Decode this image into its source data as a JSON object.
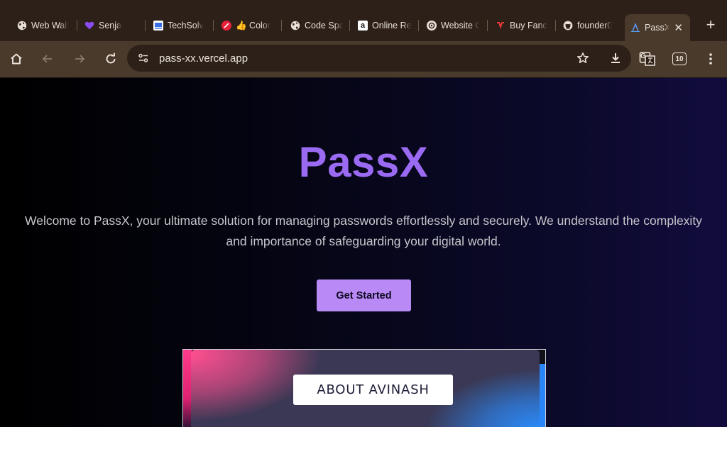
{
  "browser": {
    "tabs": [
      {
        "title": "Web Wall",
        "icon": "globe-icon"
      },
      {
        "title": "Senja",
        "icon": "heart-icon"
      },
      {
        "title": "TechSolv",
        "icon": "techsolv-icon"
      },
      {
        "title": "👍 Color",
        "icon": "color-icon"
      },
      {
        "title": "Code Spa",
        "icon": "globe-icon"
      },
      {
        "title": "Online Re",
        "icon": "amazon-icon"
      },
      {
        "title": "Website C",
        "icon": "openai-icon"
      },
      {
        "title": "Buy Fanc",
        "icon": "shop-icon"
      },
      {
        "title": "founder0",
        "icon": "github-icon"
      },
      {
        "title": "PassX",
        "icon": "passx-icon",
        "active": true
      }
    ],
    "new_tab_label": "+",
    "close_glyph": "✕",
    "address": "pass-xx.vercel.app",
    "tab_count_badge": "10",
    "translate_label": "G"
  },
  "page": {
    "title": "PassX",
    "intro": "Welcome to PassX, your ultimate solution for managing passwords effortlessly and securely. We understand the complexity and importance of safeguarding your digital world.",
    "cta_label": "Get Started",
    "about_label": "ABOUT AVINASH"
  },
  "colors": {
    "title_purple": "#9b6af2",
    "cta_bg": "#b98af6",
    "chrome_bg": "#2c2018",
    "toolbar_bg": "#4a3a2c"
  }
}
